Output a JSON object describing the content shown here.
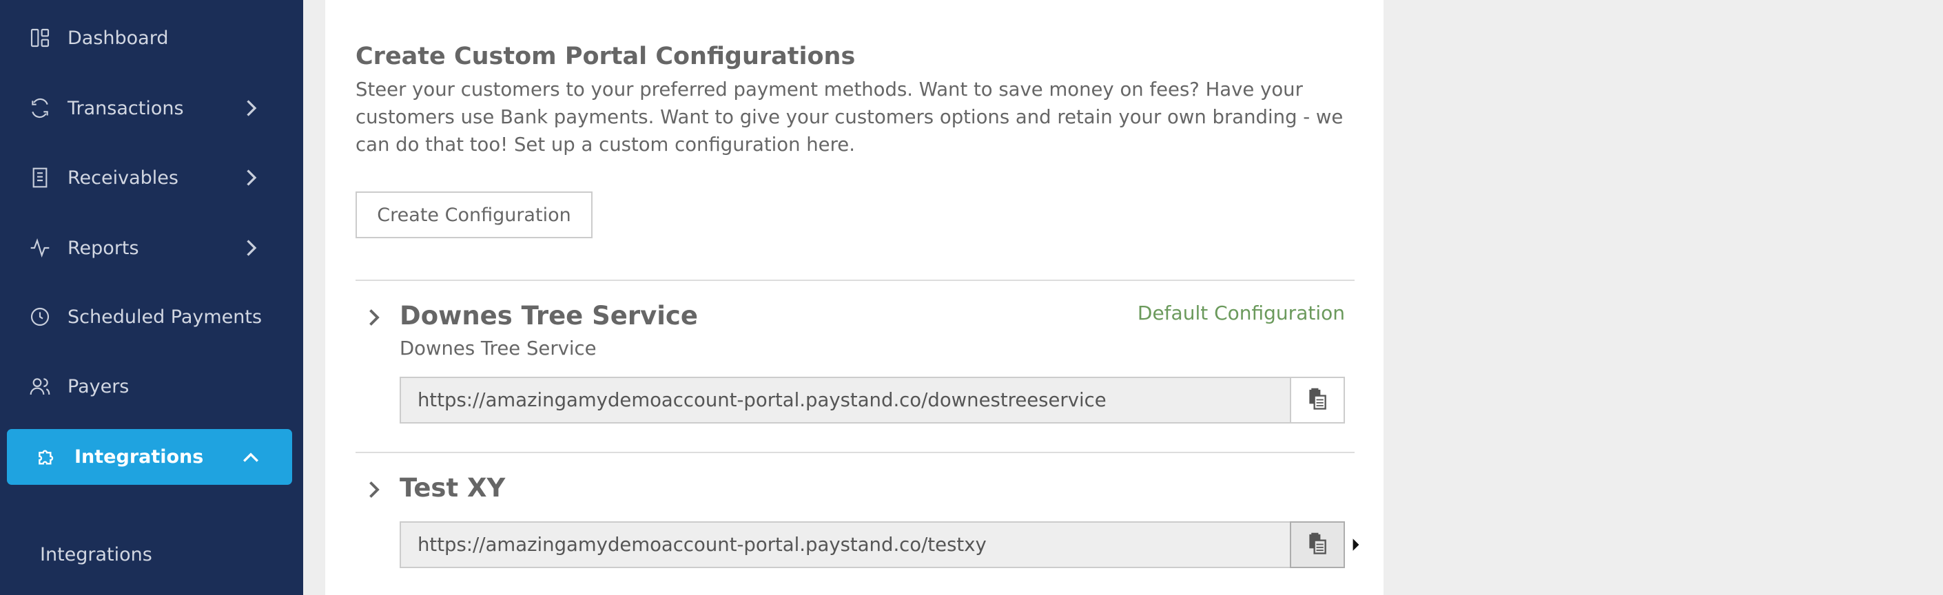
{
  "sidebar": {
    "items": [
      {
        "label": "Dashboard",
        "icon": "dashboard-icon"
      },
      {
        "label": "Transactions",
        "icon": "sync-icon"
      },
      {
        "label": "Receivables",
        "icon": "receipt-icon"
      },
      {
        "label": "Reports",
        "icon": "activity-icon"
      },
      {
        "label": "Scheduled Payments",
        "icon": "clock-icon"
      },
      {
        "label": "Payers",
        "icon": "users-icon"
      }
    ],
    "active": {
      "label": "Integrations",
      "icon": "puzzle-icon"
    },
    "subitems": [
      {
        "label": "Integrations"
      }
    ]
  },
  "main": {
    "heading": "Create Custom Portal Configurations",
    "description": "Steer your customers to your preferred payment methods. Want to save money on fees? Have your customers use Bank payments. Want to give your customers options and retain your own branding - we can do that too! Set up a custom configuration here.",
    "create_button": "Create Configuration",
    "configurations": [
      {
        "title": "Downes Tree Service",
        "subtitle": "Downes Tree Service",
        "badge": "Default Configuration",
        "url": "https://amazingamydemoaccount-portal.paystand.co/downestreeservice"
      },
      {
        "title": "Test XY",
        "url": "https://amazingamydemoaccount-portal.paystand.co/testxy"
      }
    ]
  },
  "colors": {
    "sidebar_bg": "#1b2e57",
    "active_bg": "#1fa3e0",
    "default_badge": "#6b9a5c",
    "page_bg": "#eeeeee"
  }
}
